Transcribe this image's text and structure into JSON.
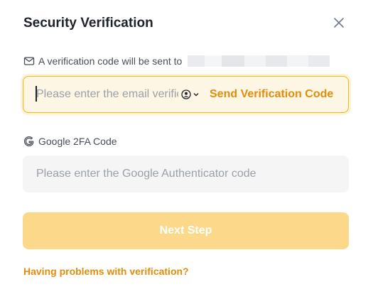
{
  "dialog": {
    "title": "Security Verification",
    "close_icon": "close-icon"
  },
  "email_section": {
    "notice": "A verification code will be sent to",
    "notice_icon": "mail-icon",
    "input_placeholder": "Please enter the email verification code",
    "account_icon": "account-icon",
    "send_label": "Send Verification Code"
  },
  "google_section": {
    "label": "Google 2FA Code",
    "label_icon": "google-icon",
    "input_placeholder": "Please enter the Google Authenticator code"
  },
  "actions": {
    "next_label": "Next Step",
    "help_link": "Having problems with verification?"
  },
  "colors": {
    "accent": "#f0b90b",
    "link": "#e08d0c",
    "button_disabled": "#fcd88a"
  }
}
